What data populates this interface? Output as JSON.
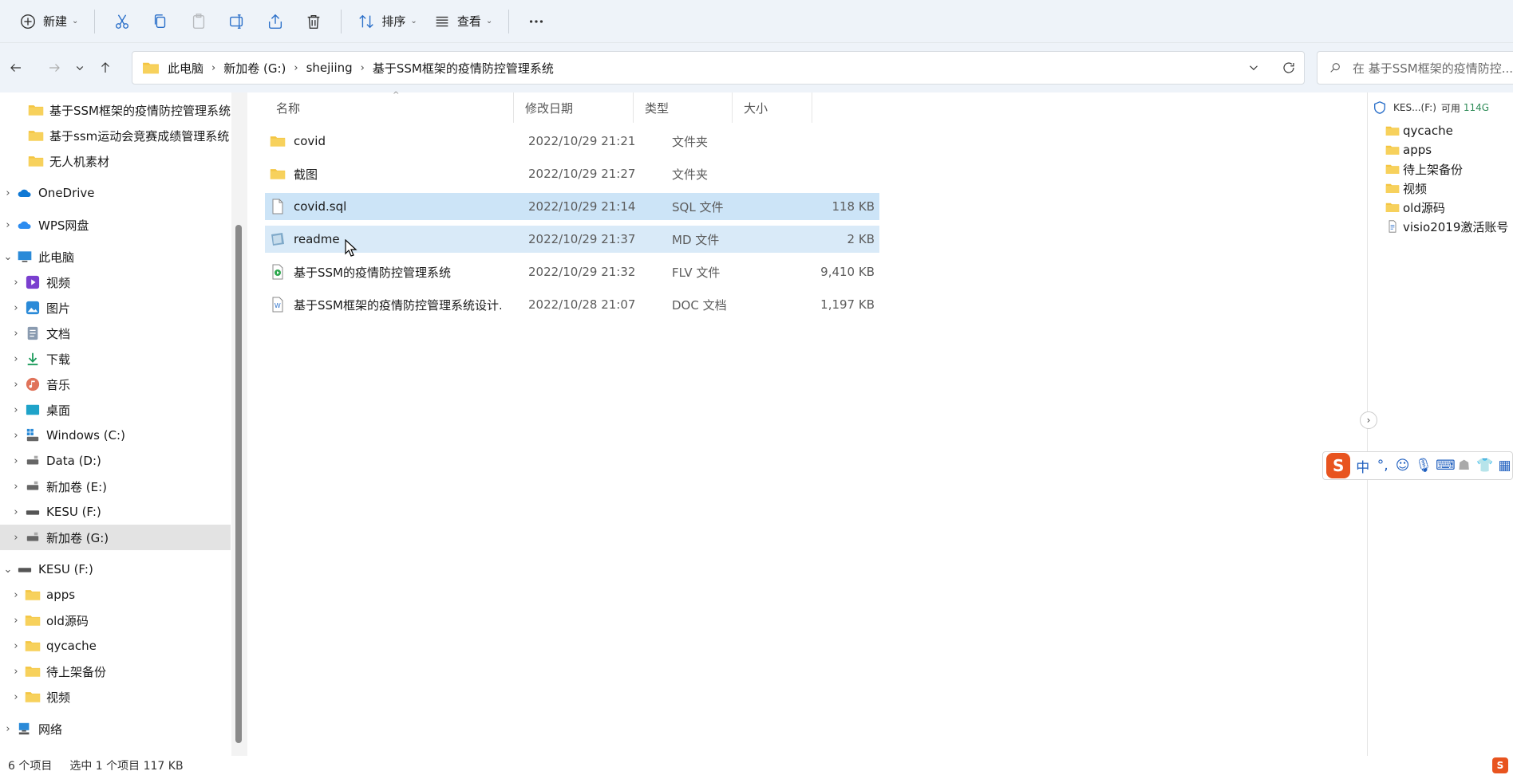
{
  "toolbar": {
    "new_label": "新建",
    "sort_label": "排序",
    "view_label": "查看"
  },
  "address": {
    "crumbs": [
      "此电脑",
      "新加卷 (G:)",
      "shejiing",
      "基于SSM框架的疫情防控管理系统"
    ]
  },
  "search": {
    "placeholder": "在 基于SSM框架的疫情防控..."
  },
  "sidebar": {
    "items": [
      {
        "label": "基于SSM框架的疫情防控管理系统",
        "icon": "folder-icon"
      },
      {
        "label": "基于ssm运动会竞赛成绩管理系统",
        "icon": "folder-icon"
      },
      {
        "label": "无人机素材",
        "icon": "folder-icon"
      },
      {
        "label": "OneDrive",
        "icon": "cloud-icon"
      },
      {
        "label": "WPS网盘",
        "icon": "cloud-icon"
      },
      {
        "label": "此电脑",
        "icon": "computer-icon"
      },
      {
        "label": "视频",
        "icon": "video-icon"
      },
      {
        "label": "图片",
        "icon": "picture-icon"
      },
      {
        "label": "文档",
        "icon": "document-icon"
      },
      {
        "label": "下载",
        "icon": "download-icon"
      },
      {
        "label": "音乐",
        "icon": "music-icon"
      },
      {
        "label": "桌面",
        "icon": "desktop-icon"
      },
      {
        "label": "Windows (C:)",
        "icon": "drive-icon"
      },
      {
        "label": "Data (D:)",
        "icon": "drive-icon"
      },
      {
        "label": "新加卷 (E:)",
        "icon": "drive-icon"
      },
      {
        "label": "KESU  (F:)",
        "icon": "usb-drive-icon"
      },
      {
        "label": "新加卷 (G:)",
        "icon": "drive-icon"
      },
      {
        "label": "KESU  (F:)",
        "icon": "usb-drive-icon"
      },
      {
        "label": "apps",
        "icon": "folder-icon"
      },
      {
        "label": "old源码",
        "icon": "folder-icon"
      },
      {
        "label": "qycache",
        "icon": "folder-icon"
      },
      {
        "label": "待上架备份",
        "icon": "folder-icon"
      },
      {
        "label": "视频",
        "icon": "folder-icon"
      },
      {
        "label": "网络",
        "icon": "network-icon"
      }
    ]
  },
  "columns": {
    "name": "名称",
    "date": "修改日期",
    "type": "类型",
    "size": "大小"
  },
  "files": [
    {
      "name": "covid",
      "date": "2022/10/29 21:21",
      "type": "文件夹",
      "size": "",
      "icon": "folder-icon"
    },
    {
      "name": "截图",
      "date": "2022/10/29 21:27",
      "type": "文件夹",
      "size": "",
      "icon": "folder-icon"
    },
    {
      "name": "covid.sql",
      "date": "2022/10/29 21:14",
      "type": "SQL 文件",
      "size": "118 KB",
      "icon": "file-icon"
    },
    {
      "name": "readme",
      "date": "2022/10/29 21:37",
      "type": "MD 文件",
      "size": "2 KB",
      "icon": "markdown-file-icon"
    },
    {
      "name": "基于SSM的疫情防控管理系统",
      "date": "2022/10/29 21:32",
      "type": "FLV 文件",
      "size": "9,410 KB",
      "icon": "video-file-icon"
    },
    {
      "name": "基于SSM框架的疫情防控管理系统设计...",
      "date": "2022/10/28 21:07",
      "type": "DOC 文档",
      "size": "1,197 KB",
      "icon": "word-file-icon"
    }
  ],
  "preview": {
    "drive_label": "KES...(F:)",
    "free_label": "可用",
    "free_value": "114G",
    "items": [
      "qycache",
      "apps",
      "待上架备份",
      "视频",
      "old源码",
      "visio2019激活账号"
    ]
  },
  "ime": {
    "logo": "S",
    "mode": "中"
  },
  "status": {
    "count": "6 个项目",
    "selection": "选中 1 个项目  117 KB"
  },
  "colors": {
    "accent": "#0067c0",
    "selected_row": "#cce4f7",
    "folder": "#f4c542"
  }
}
